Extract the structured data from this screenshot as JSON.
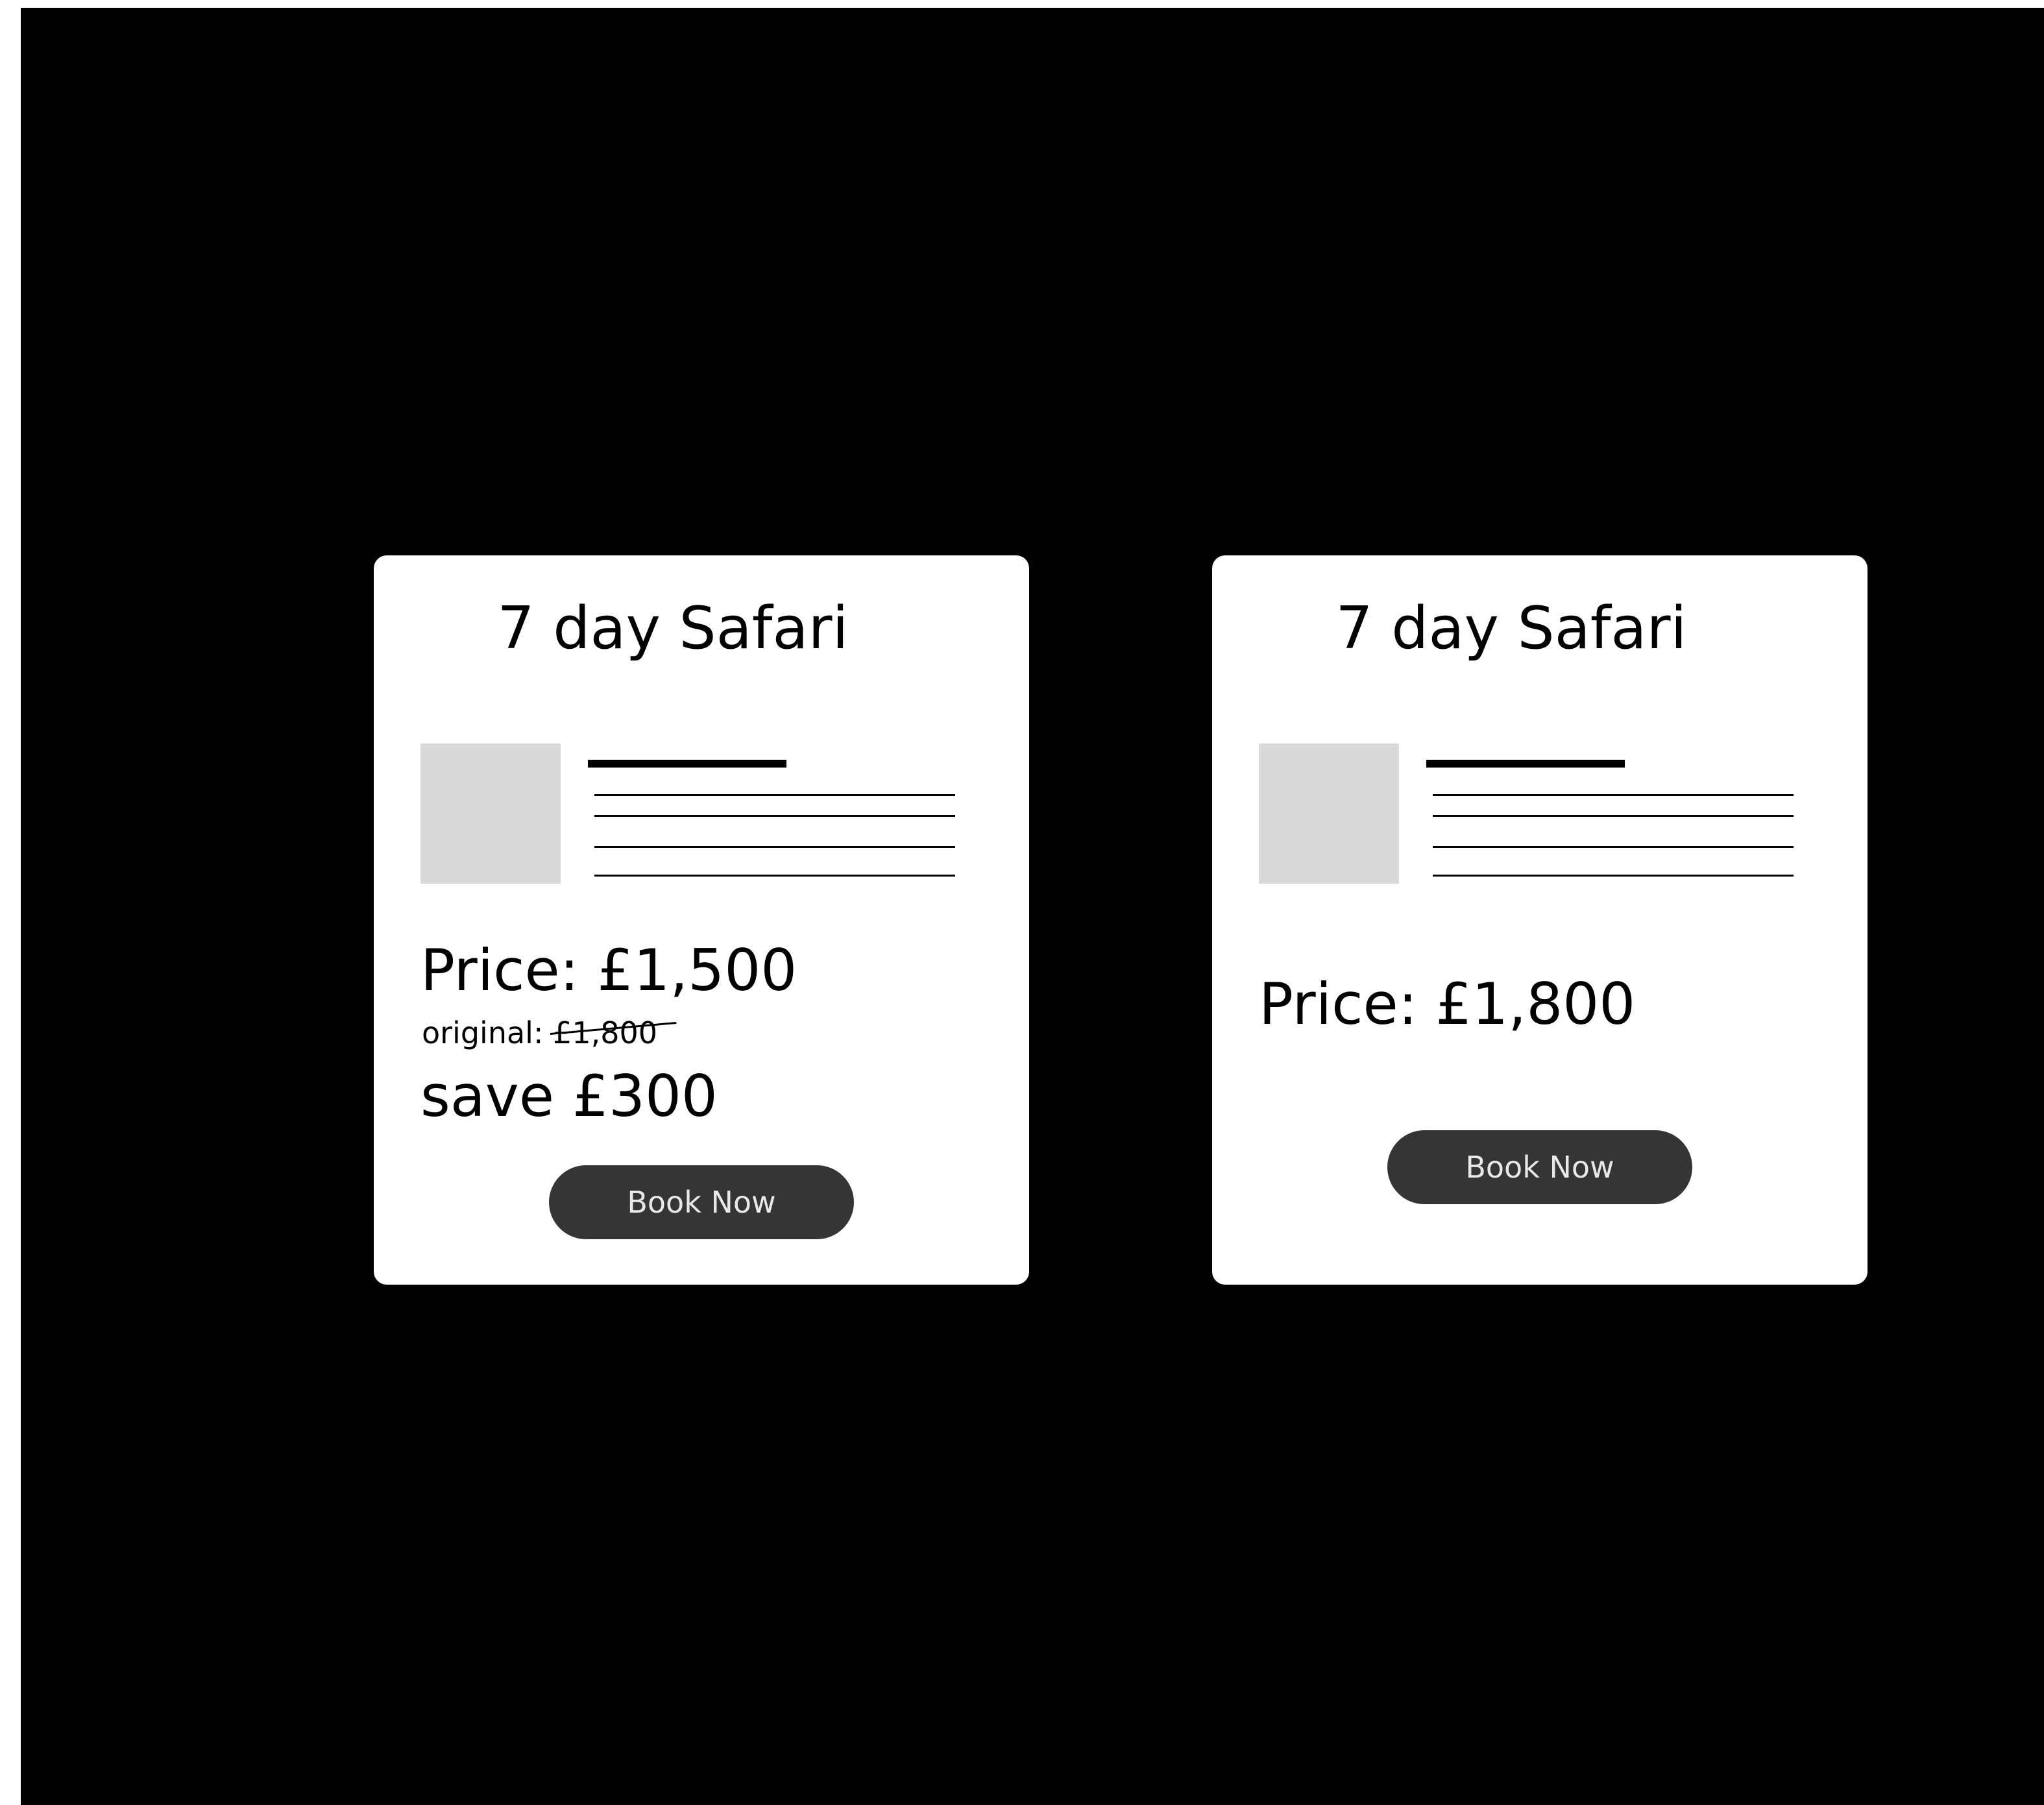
{
  "offers": [
    {
      "title": "7 day Safari",
      "price": "Price: £1,500",
      "original_label": "original:",
      "original_price": "£1,800",
      "savings": "save £300",
      "button_label": "Book Now"
    },
    {
      "title": "7 day Safari",
      "price": "Price: £1,800",
      "button_label": "Book Now"
    }
  ],
  "colors": {
    "background": "#000000",
    "card": "#ffffff",
    "image_placeholder": "#d9d9d9",
    "button": "#353535",
    "button_text": "#e8e8e8"
  },
  "icons": {
    "image_placeholder": "image-placeholder"
  }
}
